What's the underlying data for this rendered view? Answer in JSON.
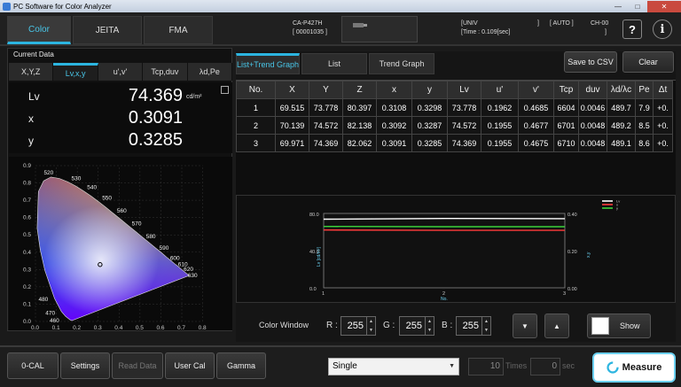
{
  "window": {
    "title": "PC Software for Color Analyzer"
  },
  "main_tabs": [
    {
      "label": "Color"
    },
    {
      "label": "JEITA"
    },
    {
      "label": "FMA"
    }
  ],
  "device": {
    "model": "CA-P427H",
    "serial": "[ 00001035 ]",
    "mode": "[UNIV",
    "mode_end": "]",
    "time": "[Time : 0.109[sec]",
    "time_end": "]",
    "auto": "[ AUTO ]",
    "channel": "CH-00"
  },
  "header_icons": {
    "help": "?",
    "info": "i"
  },
  "current_data": {
    "label": "Current Data",
    "tabs": [
      "X,Y,Z",
      "Lv,x,y",
      "u',v'",
      "Tcp,duv",
      "λd,Pe"
    ],
    "active_tab": 1,
    "rows": [
      {
        "name": "Lv",
        "value": "74.369",
        "unit": "cd/m²"
      },
      {
        "name": "x",
        "value": "0.3091",
        "unit": ""
      },
      {
        "name": "y",
        "value": "0.3285",
        "unit": ""
      }
    ]
  },
  "cie": {
    "wavelengths": [
      "520",
      "530",
      "540",
      "550",
      "560",
      "570",
      "580",
      "590",
      "600",
      "610",
      "620",
      "630",
      "480",
      "470",
      "460"
    ],
    "y_ticks": [
      "0.9",
      "0.8",
      "0.7",
      "0.6",
      "0.5",
      "0.4",
      "0.3",
      "0.2",
      "0.1",
      "0.0"
    ],
    "x_ticks": [
      "0.0",
      "0.1",
      "0.2",
      "0.3",
      "0.4",
      "0.5",
      "0.6",
      "0.7",
      "0.8"
    ],
    "point": {
      "x": 0.3091,
      "y": 0.3285
    }
  },
  "right_tabs": [
    {
      "label": "List+Trend Graph"
    },
    {
      "label": "List"
    },
    {
      "label": "Trend Graph"
    }
  ],
  "buttons": {
    "save_csv": "Save to CSV",
    "clear": "Clear"
  },
  "table": {
    "headers": [
      "No.",
      "X",
      "Y",
      "Z",
      "x",
      "y",
      "Lv",
      "u'",
      "v'",
      "Tcp",
      "duv",
      "λd/λc",
      "Pe",
      "Δt"
    ],
    "rows": [
      [
        "1",
        "69.515",
        "73.778",
        "80.397",
        "0.3108",
        "0.3298",
        "73.778",
        "0.1962",
        "0.4685",
        "6604",
        "0.0046",
        "489.7",
        "7.9",
        "+0."
      ],
      [
        "2",
        "70.139",
        "74.572",
        "82.138",
        "0.3092",
        "0.3287",
        "74.572",
        "0.1955",
        "0.4677",
        "6701",
        "0.0048",
        "489.2",
        "8.5",
        "+0."
      ],
      [
        "3",
        "69.971",
        "74.369",
        "82.062",
        "0.3091",
        "0.3285",
        "74.369",
        "0.1955",
        "0.4675",
        "6710",
        "0.0048",
        "489.1",
        "8.6",
        "+0."
      ]
    ]
  },
  "trend": {
    "y_left_ticks": [
      "80.0",
      "40.0",
      "0.0"
    ],
    "y_right_ticks": [
      "0.40",
      "0.20",
      "0.00"
    ],
    "x_ticks": [
      "1",
      "2",
      "3"
    ],
    "legend": [
      "Lv",
      "x",
      "y"
    ],
    "y_left_label": "Lv [cd/m²]",
    "y_right_label": "x,y",
    "x_label": "No.",
    "colors": {
      "lv": "#ffffff",
      "x": "#ff3b3b",
      "y": "#3bd33b"
    }
  },
  "color_window": {
    "label": "Color Window",
    "r_label": "R :",
    "g_label": "G :",
    "b_label": "B :",
    "r": "255",
    "g": "255",
    "b": "255",
    "show_label": "Show"
  },
  "bottom": {
    "buttons": [
      "0-CAL",
      "Settings",
      "Read Data",
      "User Cal",
      "Gamma"
    ],
    "mode": "Single",
    "times_value": "10",
    "times_label": "Times",
    "sec_value": "0",
    "sec_label": "sec",
    "measure": "Measure"
  }
}
